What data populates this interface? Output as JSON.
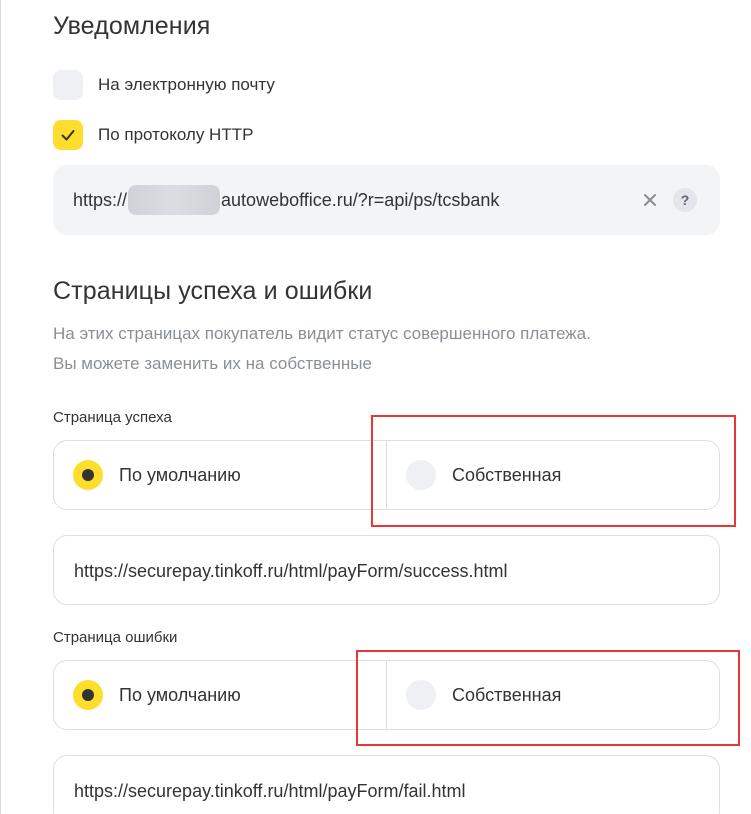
{
  "notifications": {
    "title": "Уведомления",
    "email_label": "На электронную почту",
    "email_checked": false,
    "http_label": "По протоколу HTTP",
    "http_checked": true,
    "url": {
      "prefix": "https://",
      "suffix": "autoweboffice.ru/?r=api/ps/tcsbank",
      "help_glyph": "?"
    }
  },
  "pages": {
    "title": "Страницы успеха и ошибки",
    "description_line1": "На этих страницах покупатель видит статус совершенного платежа.",
    "description_line2": "Вы можете заменить их на собственные",
    "success": {
      "label": "Страница успеха",
      "option_default": "По умолчанию",
      "option_custom": "Собственная",
      "selected": "default",
      "url": "https://securepay.tinkoff.ru/html/payForm/success.html"
    },
    "error": {
      "label": "Страница ошибки",
      "option_default": "По умолчанию",
      "option_custom": "Собственная",
      "selected": "default",
      "url": "https://securepay.tinkoff.ru/html/payForm/fail.html"
    }
  },
  "icons": {
    "clear": "close-icon",
    "help": "help-icon",
    "check": "checkmark-icon"
  },
  "colors": {
    "accent": "#ffdd2d",
    "annotation": "#e53935",
    "field_bg": "#f2f4f6",
    "muted_text": "#8a8f96"
  }
}
